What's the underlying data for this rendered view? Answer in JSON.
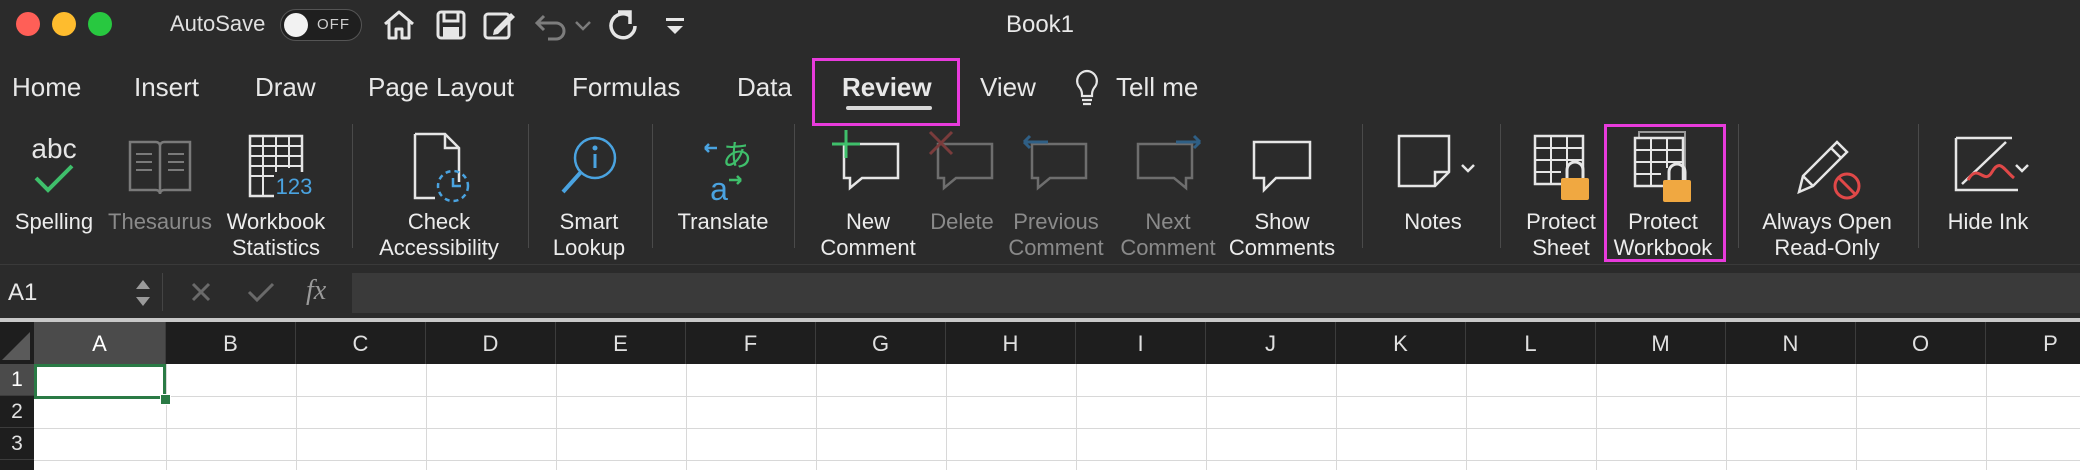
{
  "window": {
    "title": "Book1",
    "traffic_lights": [
      {
        "name": "close",
        "color": "#ff5f57"
      },
      {
        "name": "minimize",
        "color": "#febc2e"
      },
      {
        "name": "zoom",
        "color": "#28c840"
      }
    ]
  },
  "quick_access": {
    "autosave_label": "AutoSave",
    "autosave_state": "OFF",
    "icons": [
      "home-icon",
      "save-icon",
      "edit-document-icon",
      "undo-icon",
      "undo-dropdown-icon",
      "redo-icon",
      "customize-toolbar-icon"
    ]
  },
  "tabs": [
    {
      "label": "Home"
    },
    {
      "label": "Insert"
    },
    {
      "label": "Draw"
    },
    {
      "label": "Page Layout"
    },
    {
      "label": "Formulas"
    },
    {
      "label": "Data"
    },
    {
      "label": "Review",
      "active": true
    },
    {
      "label": "View"
    }
  ],
  "tell_me": "Tell me",
  "ribbon": {
    "spelling": {
      "line1": "Spelling",
      "line2": "",
      "icon_text": "abc"
    },
    "thesaurus": {
      "line1": "Thesaurus",
      "line2": "",
      "enabled": false
    },
    "workbook_statistics": {
      "line1": "Workbook",
      "line2": "Statistics",
      "icon_text": "123"
    },
    "check_accessibility": {
      "line1": "Check",
      "line2": "Accessibility"
    },
    "smart_lookup": {
      "line1": "Smart",
      "line2": "Lookup"
    },
    "translate": {
      "line1": "Translate",
      "line2": "",
      "icon_text_a": "a",
      "icon_text_b": "あ"
    },
    "new_comment": {
      "line1": "New",
      "line2": "Comment"
    },
    "delete": {
      "line1": "Delete",
      "line2": "",
      "enabled": false
    },
    "previous_comment": {
      "line1": "Previous",
      "line2": "Comment",
      "enabled": false
    },
    "next_comment": {
      "line1": "Next",
      "line2": "Comment",
      "enabled": false
    },
    "show_comments": {
      "line1": "Show",
      "line2": "Comments"
    },
    "notes": {
      "line1": "Notes",
      "line2": ""
    },
    "protect_sheet": {
      "line1": "Protect",
      "line2": "Sheet"
    },
    "protect_workbook": {
      "line1": "Protect",
      "line2": "Workbook"
    },
    "always_open_read_only": {
      "line1": "Always Open",
      "line2": "Read-Only"
    },
    "hide_ink": {
      "line1": "Hide Ink",
      "line2": ""
    }
  },
  "formula_bar": {
    "name_box": "A1",
    "fx": "fx",
    "value": ""
  },
  "sheet": {
    "columns": [
      "A",
      "B",
      "C",
      "D",
      "E",
      "F",
      "G",
      "H",
      "I",
      "J",
      "K",
      "L",
      "M",
      "N",
      "O",
      "P"
    ],
    "rows": [
      "1",
      "2",
      "3"
    ],
    "selected_cell": "A1"
  },
  "colors": {
    "highlight": "#e83bdc",
    "accent_green": "#2a7a45",
    "lock_orange": "#f0a841"
  }
}
